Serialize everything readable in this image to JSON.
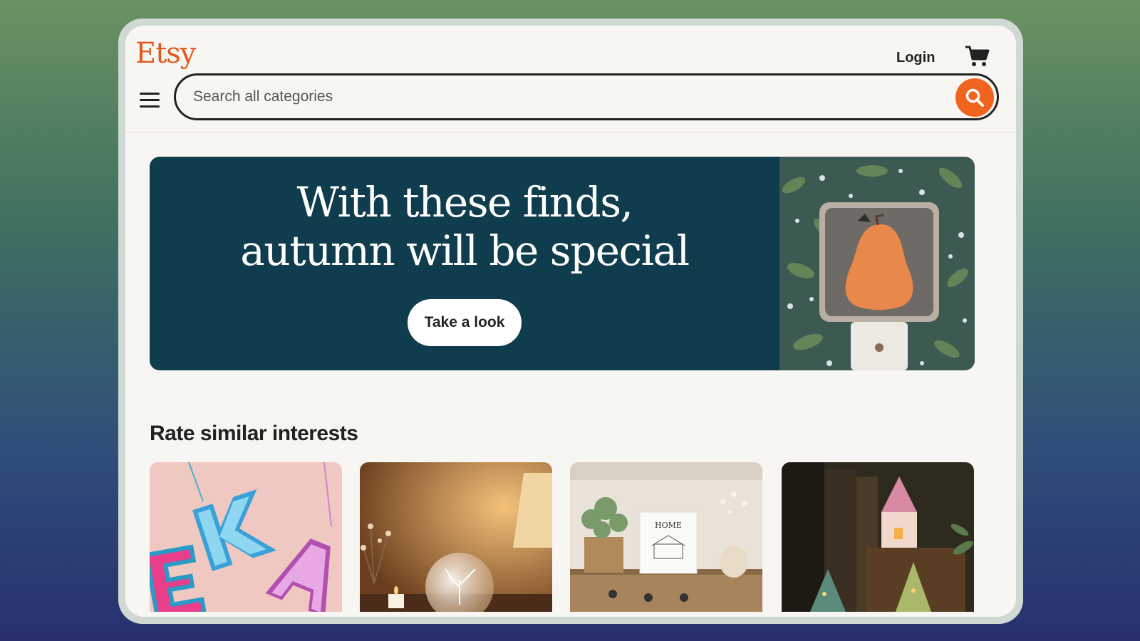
{
  "header": {
    "logo": "Etsy",
    "login_label": "Login",
    "cart_icon": "cart-icon",
    "menu_icon": "hamburger-menu-icon"
  },
  "search": {
    "placeholder": "Search all categories",
    "button_icon": "search-icon"
  },
  "banner": {
    "title_line1": "With these finds,",
    "title_line2": "autumn will be special",
    "button_label": "Take a look",
    "background_color": "#0f3d4d"
  },
  "section": {
    "title": "Rate similar interests"
  },
  "colors": {
    "brand": "#e4591b",
    "search_button": "#f1641e",
    "page_background": "#f8f6f2"
  }
}
